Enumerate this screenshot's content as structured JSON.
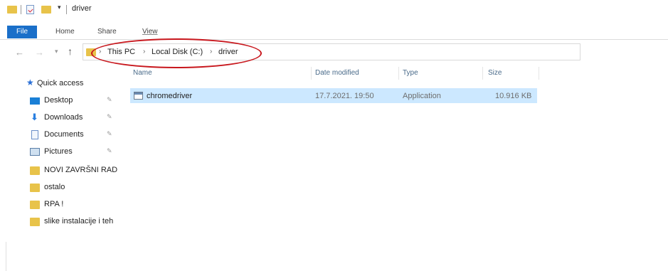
{
  "window": {
    "title": "driver",
    "quick_access_dropdown": "▾"
  },
  "ribbon": {
    "tabs": [
      "File",
      "Home",
      "Share",
      "View"
    ]
  },
  "nav": {
    "back": "←",
    "forward": "→",
    "recent": "▾",
    "up": "↑"
  },
  "address": {
    "crumbs": [
      "This PC",
      "Local Disk (C:)",
      "driver"
    ],
    "separator": "›"
  },
  "sidebar": {
    "items": [
      {
        "label": "Quick access",
        "icon": "star-icon",
        "pinned": false
      },
      {
        "label": "Desktop",
        "icon": "desktop-icon",
        "pinned": true
      },
      {
        "label": "Downloads",
        "icon": "download-icon",
        "pinned": true
      },
      {
        "label": "Documents",
        "icon": "documents-icon",
        "pinned": true
      },
      {
        "label": "Pictures",
        "icon": "pictures-icon",
        "pinned": true
      },
      {
        "label": "NOVI ZAVRŠNI RAD",
        "icon": "folder-icon",
        "pinned": false
      },
      {
        "label": "ostalo",
        "icon": "folder-icon",
        "pinned": false
      },
      {
        "label": "RPA !",
        "icon": "folder-icon",
        "pinned": false
      },
      {
        "label": "slike instalacije i teh",
        "icon": "folder-icon",
        "pinned": false
      }
    ],
    "pin_glyph": "✎"
  },
  "files": {
    "columns": [
      "Name",
      "Date modified",
      "Type",
      "Size"
    ],
    "rows": [
      {
        "name": "chromedriver",
        "date": "17.7.2021. 19:50",
        "type": "Application",
        "size": "10.916 KB",
        "icon": "application-icon"
      }
    ]
  },
  "colors": {
    "file_tab": "#1a6fc9",
    "selection": "#cce8ff",
    "annotation": "#c8171d",
    "folder": "#e8c34a"
  }
}
